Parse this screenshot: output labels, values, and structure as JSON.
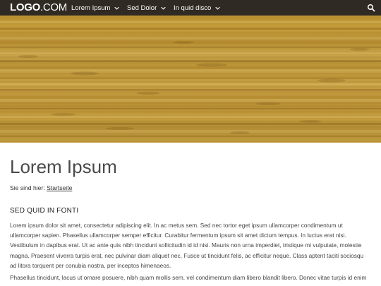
{
  "header": {
    "logo_strong": "LOGO",
    "logo_light": ".COM",
    "nav": [
      {
        "label": "Lorem Ipsum"
      },
      {
        "label": "Sed Dolor"
      },
      {
        "label": "In quid disco"
      }
    ],
    "search_icon": "search-icon",
    "background": "#2f2a23"
  },
  "hero": {
    "description_color": "#b8902f"
  },
  "main": {
    "title": "Lorem Ipsum",
    "breadcrumb_prefix": "Sie sind hier:",
    "breadcrumb_link": "Startseite",
    "section_heading": "SED QUID IN FONTI",
    "paragraphs": [
      "Lorem ipsum dolor sit amet, consectetur adipiscing elit. In ac metus sem. Sed nec tortor eget ipsum ullamcorper condimentum ut ullamcorper sapien. Phasellus ullamcorper semper efficitur. Curabitur fermentum ipsum sit amet dictum tempus. In luctus erat nisi. Vestibulum in dapibus erat. Ut ac ante quis nibh tincidunt sollicitudin id id nisi. Mauris non urna imperdiet, tristique mi vulputate, molestie magna. Praesent viverra turpis erat, nec pulvinar diam aliquet nec. Fusce ut tincidunt felis, ac efficitur neque. Class aptent taciti sociosqu ad litora torquent per conubia nostra, per inceptos himenaeos.",
      "Phasellus tincidunt, lacus ut ornare posuere, nibh quam mollis sem, vel condimentum diam libero blandit libero. Donec vitae turpis id enim"
    ]
  }
}
